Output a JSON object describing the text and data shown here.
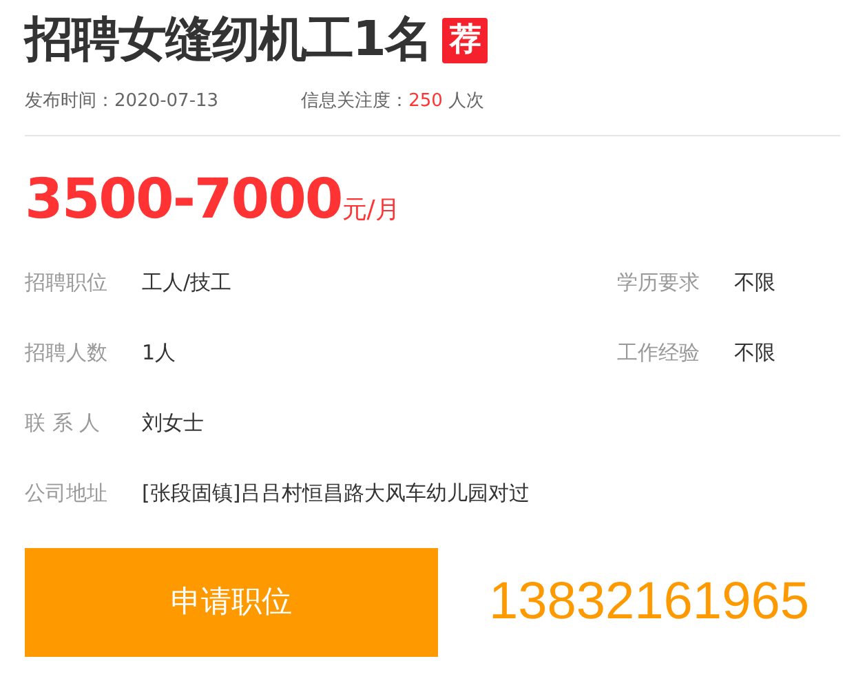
{
  "title": "招聘女缝纫机工1名",
  "badge": "荐",
  "meta": [
    {
      "label": "发布时间：",
      "value": "2020-07-13",
      "highlight": false
    },
    {
      "label": "信息关注度：",
      "value": "250",
      "unit": "人次",
      "highlight": true
    }
  ],
  "salary": {
    "amount": "3500-7000",
    "unit": "元/月"
  },
  "details": [
    [
      {
        "label": "招聘职位",
        "value": "工人/技工"
      },
      {
        "label": "学历要求",
        "value": "不限"
      }
    ],
    [
      {
        "label": "招聘人数",
        "value": "1人"
      },
      {
        "label": "工作经验",
        "value": "不限"
      }
    ],
    [
      {
        "label": "联 系 人",
        "value": "刘女士"
      }
    ],
    [
      {
        "label": "公司地址",
        "value": "[张段固镇]吕吕村恒昌路大风车幼儿园对过"
      }
    ]
  ],
  "apply_button": "申请职位",
  "phone": "13832161965"
}
